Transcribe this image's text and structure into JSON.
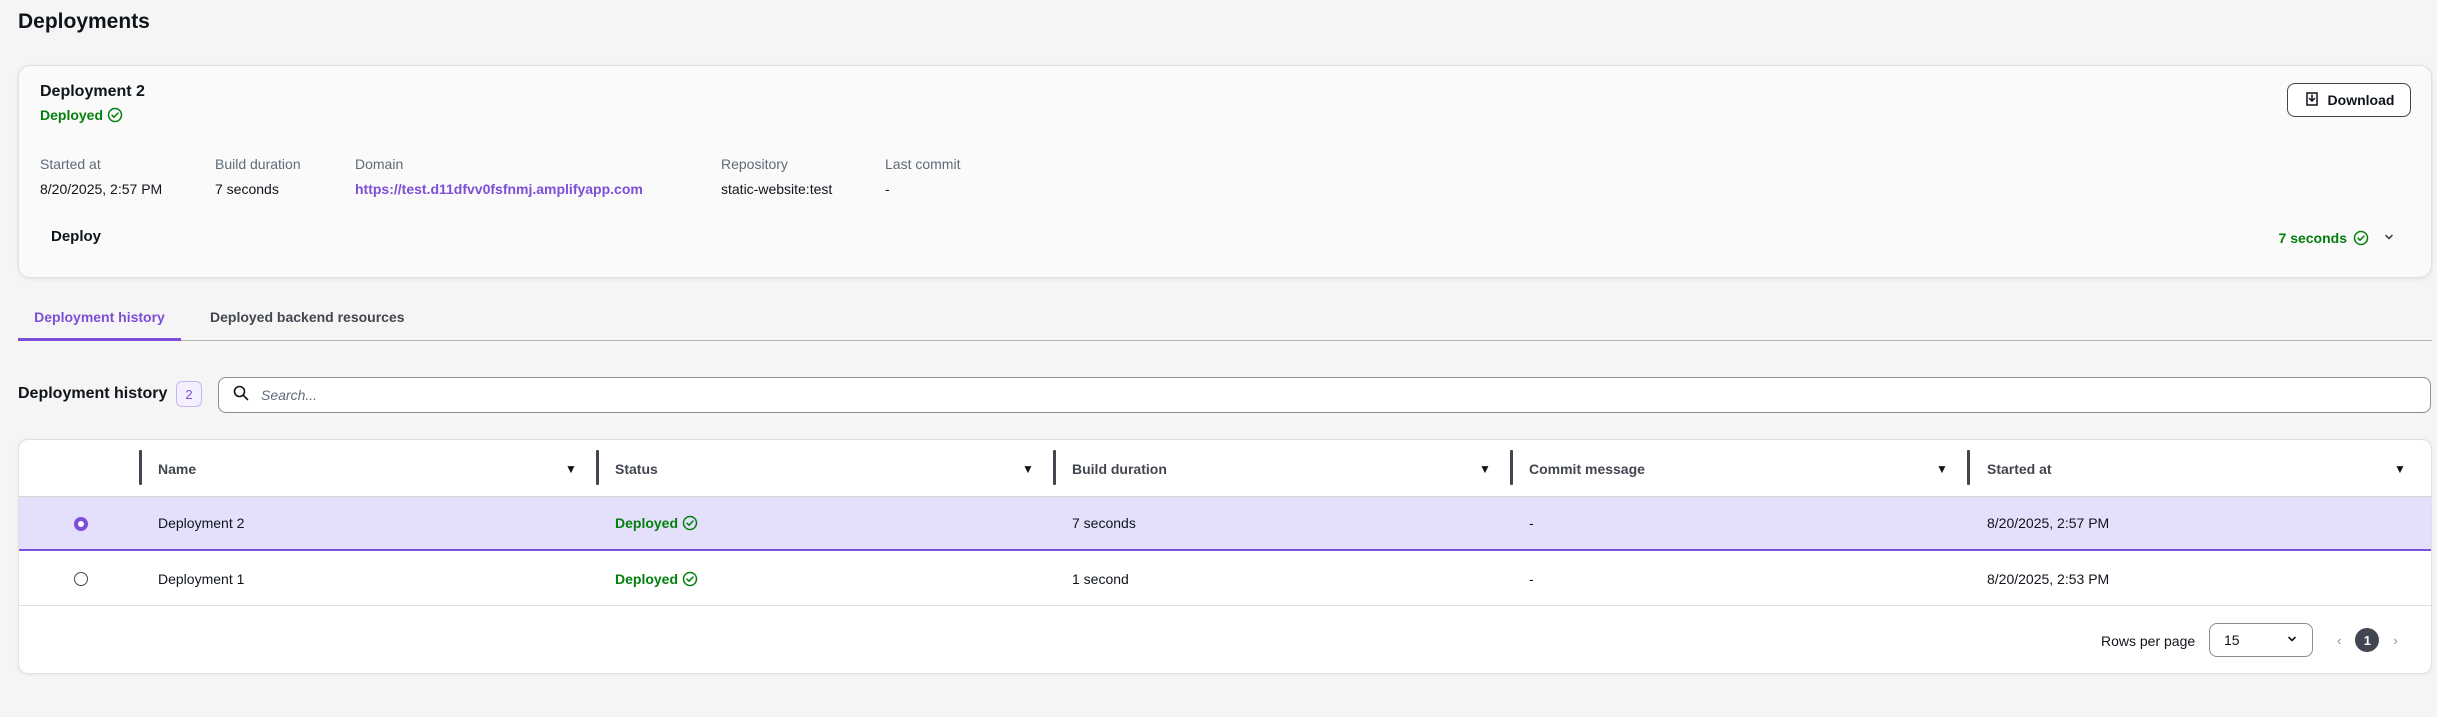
{
  "page": {
    "title": "Deployments"
  },
  "summary": {
    "deployment_name": "Deployment 2",
    "status": "Deployed",
    "download_label": "Download",
    "fields": {
      "started_at_label": "Started at",
      "started_at_value": "8/20/2025, 2:57 PM",
      "build_duration_label": "Build duration",
      "build_duration_value": "7 seconds",
      "domain_label": "Domain",
      "domain_value": "https://test.d11dfvv0fsfnmj.amplifyapp.com",
      "repository_label": "Repository",
      "repository_value": "static-website:test",
      "last_commit_label": "Last commit",
      "last_commit_value": "-"
    },
    "step_label": "Deploy",
    "step_duration": "7 seconds"
  },
  "tabs": [
    {
      "label": "Deployment history",
      "active": true
    },
    {
      "label": "Deployed backend resources",
      "active": false
    }
  ],
  "history": {
    "title": "Deployment history",
    "count": "2",
    "search_placeholder": "Search...",
    "columns": [
      "Name",
      "Status",
      "Build duration",
      "Commit message",
      "Started at"
    ],
    "rows": [
      {
        "name": "Deployment 2",
        "status": "Deployed",
        "build_duration": "7 seconds",
        "commit_message": "-",
        "started_at": "8/20/2025, 2:57 PM",
        "selected": true
      },
      {
        "name": "Deployment 1",
        "status": "Deployed",
        "build_duration": "1 second",
        "commit_message": "-",
        "started_at": "8/20/2025, 2:53 PM",
        "selected": false
      }
    ],
    "rows_per_page_label": "Rows per page",
    "rows_per_page_value": "15",
    "current_page": "1"
  },
  "colors": {
    "accent": "#7d4ed8",
    "success": "#037f0c",
    "selected_row": "#e4e0fc"
  },
  "icons": [
    "success-check-icon",
    "download-icon",
    "chevron-down-icon",
    "search-icon",
    "sort-caret-icon",
    "pager-prev-icon",
    "pager-next-icon"
  ]
}
